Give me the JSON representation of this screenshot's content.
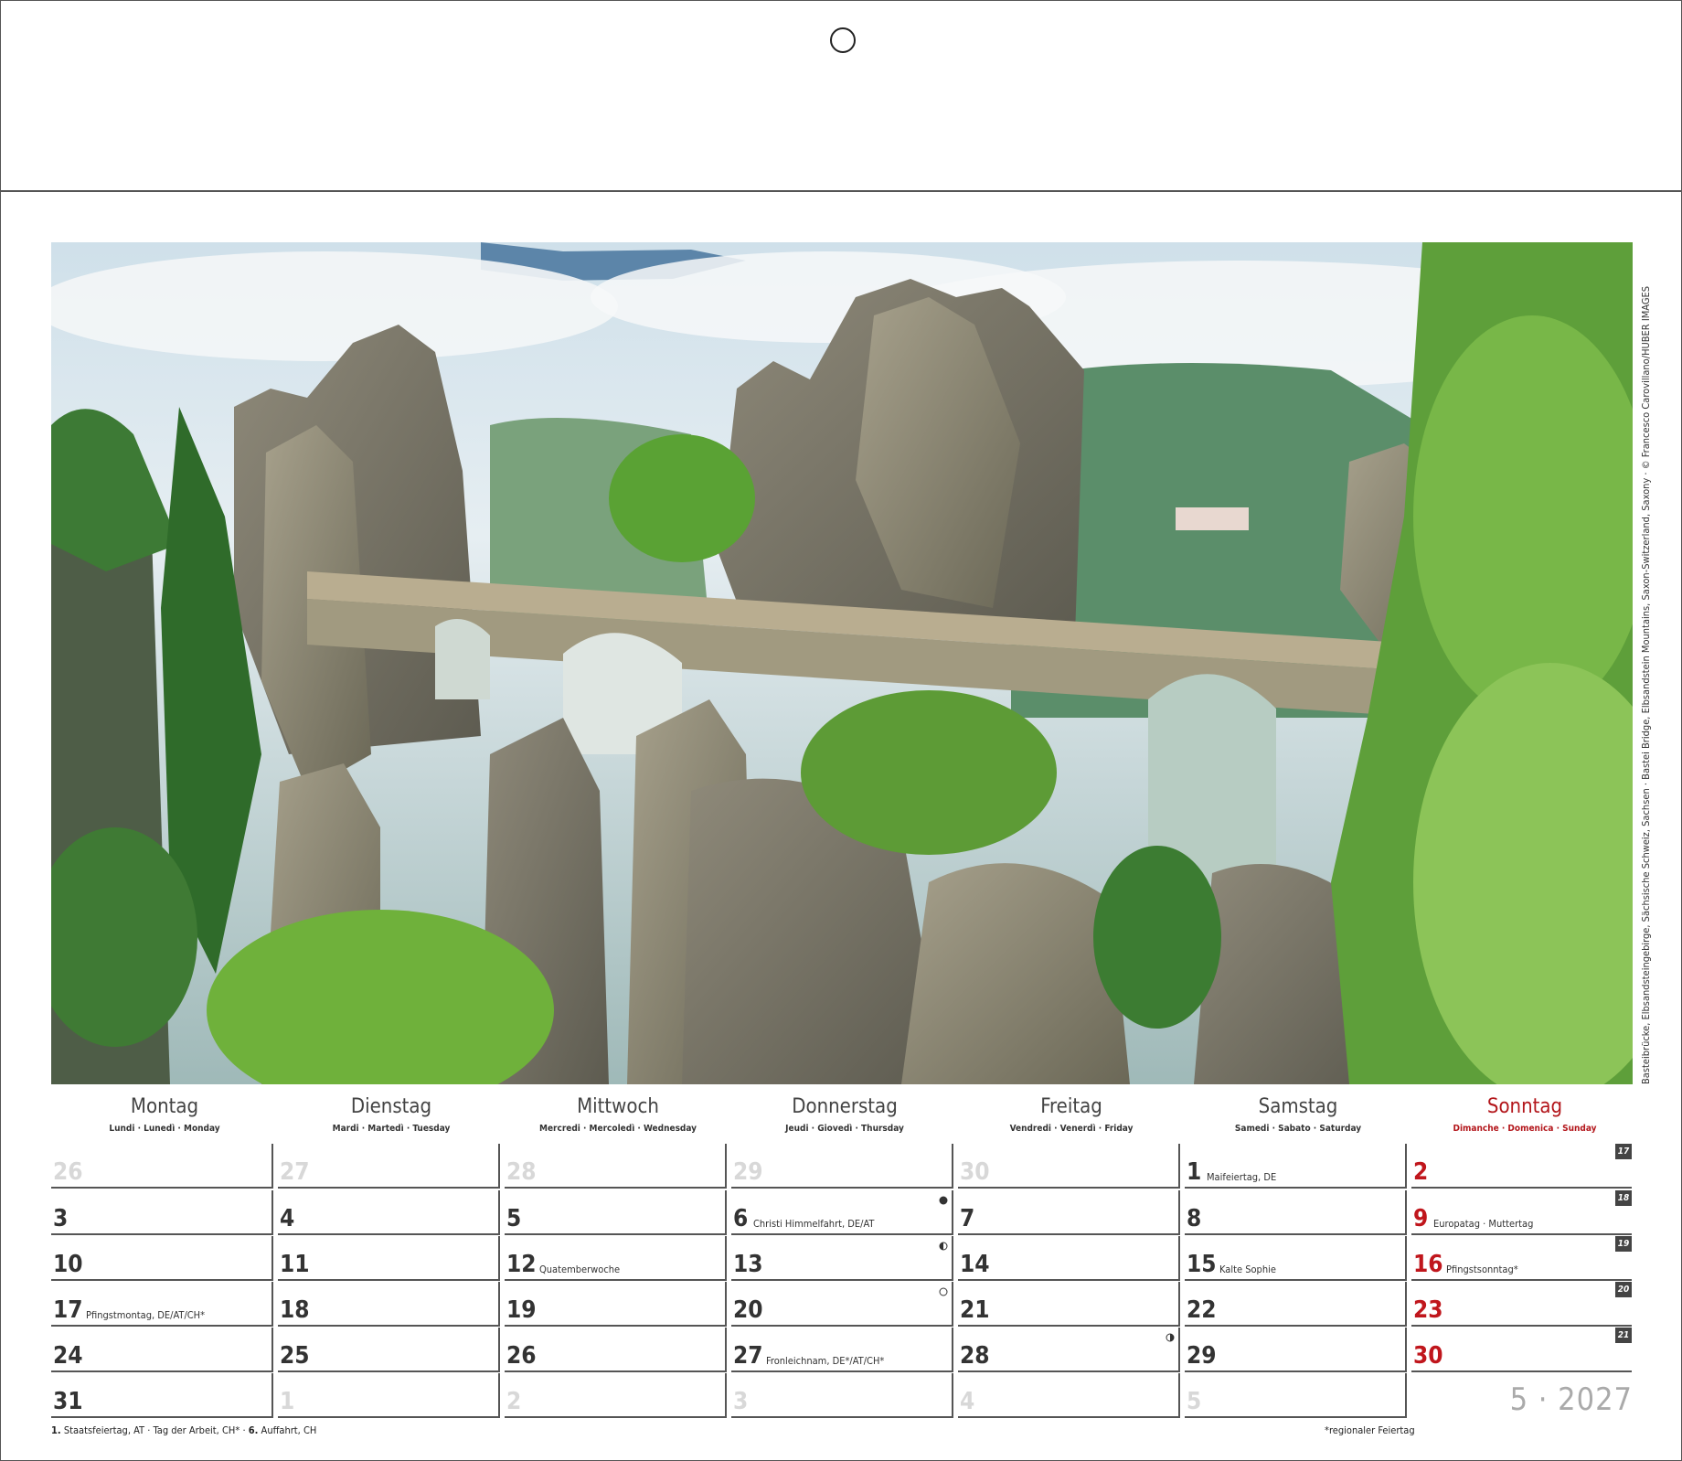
{
  "photo": {
    "caption": "Basteibrücke, Elbsandsteingebirge, Sächsische Schweiz, Sachsen · Bastei Bridge, Elbsandstein Mountains, Saxon-Switzerland, Saxony · © Francesco Carovillano/HUBER IMAGES"
  },
  "weekdays": [
    {
      "name": "Montag",
      "sub": "Lundi · Lunedì · Monday"
    },
    {
      "name": "Dienstag",
      "sub": "Mardi · Martedì · Tuesday"
    },
    {
      "name": "Mittwoch",
      "sub": "Mercredi · Mercoledì · Wednesday"
    },
    {
      "name": "Donnerstag",
      "sub": "Jeudi · Giovedì · Thursday"
    },
    {
      "name": "Freitag",
      "sub": "Vendredi · Venerdì · Friday"
    },
    {
      "name": "Samstag",
      "sub": "Samedi · Sabato · Saturday"
    },
    {
      "name": "Sonntag",
      "sub": "Dimanche · Domenica · Sunday"
    }
  ],
  "weeks": [
    {
      "week": "17",
      "days": [
        {
          "num": "26",
          "other": true
        },
        {
          "num": "27",
          "other": true
        },
        {
          "num": "28",
          "other": true
        },
        {
          "num": "29",
          "other": true
        },
        {
          "num": "30",
          "other": true
        },
        {
          "num": "1",
          "note": "Maifeiertag, DE"
        },
        {
          "num": "2"
        }
      ]
    },
    {
      "week": "18",
      "days": [
        {
          "num": "3"
        },
        {
          "num": "4"
        },
        {
          "num": "5"
        },
        {
          "num": "6",
          "note": "Christi Himmelfahrt, DE/AT",
          "moon": "full"
        },
        {
          "num": "7"
        },
        {
          "num": "8"
        },
        {
          "num": "9",
          "note": "Europatag · Muttertag"
        }
      ]
    },
    {
      "week": "19",
      "days": [
        {
          "num": "10"
        },
        {
          "num": "11"
        },
        {
          "num": "12",
          "note": "Quatemberwoche"
        },
        {
          "num": "13",
          "moon": "half"
        },
        {
          "num": "14"
        },
        {
          "num": "15",
          "note": "Kalte Sophie"
        },
        {
          "num": "16",
          "note": "Pfingstsonntag*"
        }
      ]
    },
    {
      "week": "20",
      "days": [
        {
          "num": "17",
          "note": "Pfingstmontag, DE/AT/CH*"
        },
        {
          "num": "18"
        },
        {
          "num": "19"
        },
        {
          "num": "20",
          "moon": "new"
        },
        {
          "num": "21"
        },
        {
          "num": "22"
        },
        {
          "num": "23"
        }
      ]
    },
    {
      "week": "21",
      "days": [
        {
          "num": "24"
        },
        {
          "num": "25"
        },
        {
          "num": "26"
        },
        {
          "num": "27",
          "note": "Fronleichnam, DE*/AT/CH*"
        },
        {
          "num": "28",
          "moon": "quarter"
        },
        {
          "num": "29"
        },
        {
          "num": "30"
        }
      ]
    },
    {
      "week": "",
      "days": [
        {
          "num": "31"
        },
        {
          "num": "1",
          "other": true
        },
        {
          "num": "2",
          "other": true
        },
        {
          "num": "3",
          "other": true
        },
        {
          "num": "4",
          "other": true
        },
        {
          "num": "5",
          "other": true
        }
      ]
    }
  ],
  "month_label": "5 · 2027",
  "footnote_left": {
    "n1": "1.",
    "t1": "Staatsfeiertag, AT",
    "t2": "Tag der Arbeit, CH*",
    "n3": "6.",
    "t3": "Auffahrt, CH"
  },
  "footnote_right": "*regionaler Feiertag",
  "colors": {
    "sunday": "#c0161c",
    "rule": "#555555",
    "week_badge": "#444444"
  }
}
